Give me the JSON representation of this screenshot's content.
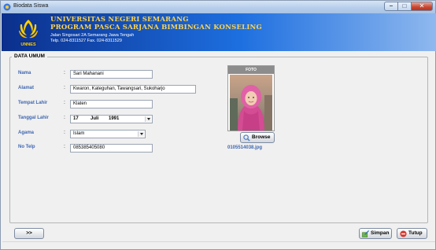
{
  "window": {
    "title": "Biodata Siswa",
    "controls": {
      "minimize": "–",
      "maximize": "□",
      "close": "✕"
    }
  },
  "header": {
    "line1": "UNIVERSITAS NEGERI SEMARANG",
    "line2": "PROGRAM PASCA SARJANA BIMBINGAN KONSELING",
    "address": "Jalan Singosari 2A Semarang Jawa Tengah",
    "phone": "Telp. 024-8311527 Fax. 024-8311529",
    "logo_text": "UNNES"
  },
  "form": {
    "section_title": "DATA UMUM",
    "nama": {
      "label": "Nama",
      "value": "Sari Mahanani"
    },
    "alamat": {
      "label": "Alamat",
      "value": "Kwaron, Kateguhan, Tawangsari, Sukoharjo"
    },
    "tempat_lahir": {
      "label": "Tempat Lahir",
      "value": "Klaten"
    },
    "tanggal_lahir": {
      "label": "Tanggal Lahir",
      "day": "17",
      "month": "Juli",
      "year": "1991"
    },
    "agama": {
      "label": "Agama",
      "value": "Islam"
    },
    "no_telp": {
      "label": "No Telp",
      "value": "085385405080"
    },
    "colon": ":"
  },
  "photo": {
    "title": "FOTO",
    "browse_label": "Browse",
    "filename": "0105514038.jpg"
  },
  "footer": {
    "next_label": ">>",
    "save_label": "Simpan",
    "close_label": "Tutup"
  },
  "colors": {
    "label_blue": "#3f66b0",
    "header_gold": "#ffd34a",
    "header_dark": "#0b2f8c",
    "header_light": "#8fb8ee"
  }
}
